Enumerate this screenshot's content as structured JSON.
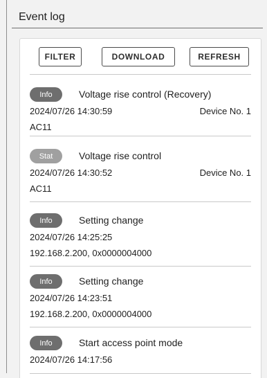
{
  "header": {
    "title": "Event log"
  },
  "toolbar": {
    "filter_label": "FILTER",
    "download_label": "DOWNLOAD",
    "refresh_label": "REFRESH"
  },
  "entries": [
    {
      "badge": "Info",
      "message": "Voltage rise control (Recovery)",
      "timestamp": "2024/07/26 14:30:59",
      "device": "Device No. 1",
      "detail": "AC11"
    },
    {
      "badge": "Stat",
      "message": "Voltage rise control",
      "timestamp": "2024/07/26 14:30:52",
      "device": "Device No. 1",
      "detail": "AC11"
    },
    {
      "badge": "Info",
      "message": "Setting change",
      "timestamp": "2024/07/26 14:25:25",
      "device": "",
      "detail": "192.168.2.200, 0x0000004000"
    },
    {
      "badge": "Info",
      "message": "Setting change",
      "timestamp": "2024/07/26 14:23:51",
      "device": "",
      "detail": "192.168.2.200, 0x0000004000"
    },
    {
      "badge": "Info",
      "message": "Start access point mode",
      "timestamp": "2024/07/26 14:17:56",
      "device": "",
      "detail": ""
    }
  ],
  "colors": {
    "badge_info": "#6e6e6e",
    "badge_stat": "#a0a0a0"
  }
}
